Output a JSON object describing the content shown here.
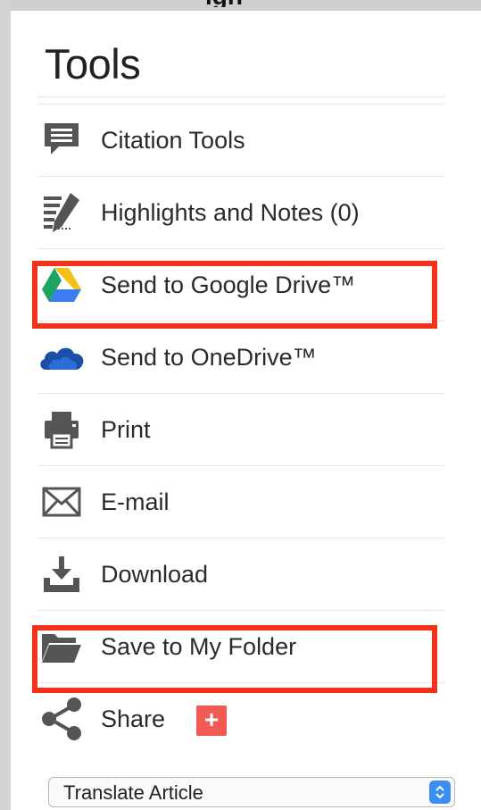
{
  "top_label": "ign",
  "panel": {
    "title": "Tools"
  },
  "menu": {
    "items": [
      {
        "label": "Citation Tools",
        "icon": "speech-bubble-icon"
      },
      {
        "label": "Highlights and Notes (0)",
        "icon": "notes-pen-icon"
      },
      {
        "label": "Send to Google Drive™",
        "icon": "google-drive-icon"
      },
      {
        "label": "Send to OneDrive™",
        "icon": "onedrive-cloud-icon"
      },
      {
        "label": "Print",
        "icon": "printer-icon"
      },
      {
        "label": "E-mail",
        "icon": "envelope-icon"
      },
      {
        "label": "Download",
        "icon": "download-icon"
      },
      {
        "label": "Save to My Folder",
        "icon": "folder-icon"
      },
      {
        "label": "Share",
        "icon": "share-icon",
        "badge": "+"
      }
    ]
  },
  "translate": {
    "selected": "Translate Article"
  },
  "colors": {
    "highlight_border": "#f3321c",
    "icon_gray": "#555555",
    "onedrive_blue": "#1d4fa8",
    "share_badge": "#f25b54",
    "select_arrow_bg": "#3a8ef2"
  }
}
